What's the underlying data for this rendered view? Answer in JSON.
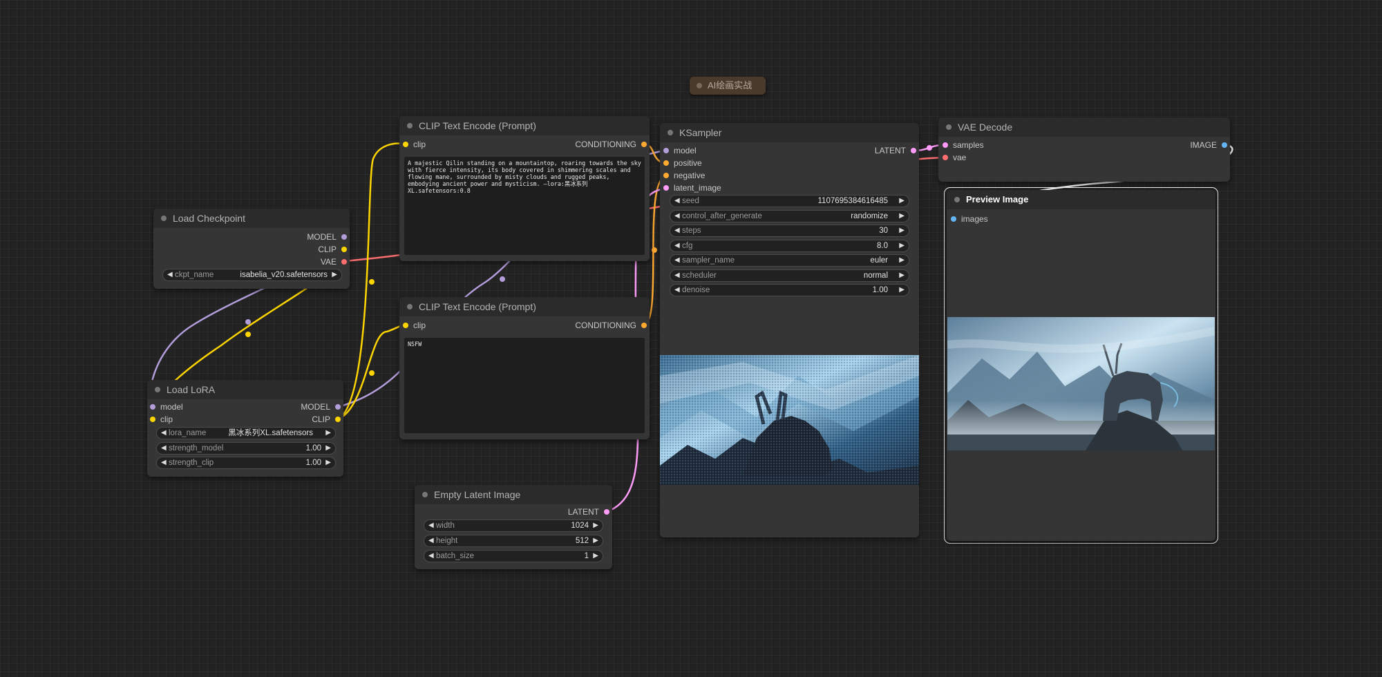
{
  "group": {
    "title": "AI绘画实战"
  },
  "colors": {
    "model": "#b39ddb",
    "clip": "#ffd500",
    "vae": "#ff6e6e",
    "conditioning": "#ffa931",
    "latent": "#ff9cf9",
    "image": "#64b5f6",
    "background": "#222222",
    "node_body": "#353535",
    "node_title": "#2b2b2b"
  },
  "nodes": {
    "load_checkpoint": {
      "title": "Load Checkpoint",
      "outputs": [
        "MODEL",
        "CLIP",
        "VAE"
      ],
      "widgets": [
        {
          "label": "ckpt_name",
          "value": "isabelia_v20.safetensors"
        }
      ]
    },
    "load_lora": {
      "title": "Load LoRA",
      "inputs": [
        "model",
        "clip"
      ],
      "outputs": [
        "MODEL",
        "CLIP"
      ],
      "widgets": [
        {
          "label": "lora_name",
          "value": "黑冰系列XL.safetensors"
        },
        {
          "label": "strength_model",
          "value": "1.00"
        },
        {
          "label": "strength_clip",
          "value": "1.00"
        }
      ]
    },
    "clip_text_pos": {
      "title": "CLIP Text Encode (Prompt)",
      "input": "clip",
      "output": "CONDITIONING",
      "text": "A majestic Qilin standing on a mountaintop, roaring towards the sky with fierce intensity, its body covered in shimmering scales and flowing mane, surrounded by misty clouds and rugged peaks, embodying ancient power and mysticism. —lora:黑冰系列XL.safetensors:0.8"
    },
    "clip_text_neg": {
      "title": "CLIP Text Encode (Prompt)",
      "input": "clip",
      "output": "CONDITIONING",
      "text": "NSFW"
    },
    "ksampler": {
      "title": "KSampler",
      "inputs": [
        "model",
        "positive",
        "negative",
        "latent_image"
      ],
      "output": "LATENT",
      "widgets": [
        {
          "label": "seed",
          "value": "1107695384616485"
        },
        {
          "label": "control_after_generate",
          "value": "randomize"
        },
        {
          "label": "steps",
          "value": "30"
        },
        {
          "label": "cfg",
          "value": "8.0"
        },
        {
          "label": "sampler_name",
          "value": "euler"
        },
        {
          "label": "scheduler",
          "value": "normal"
        },
        {
          "label": "denoise",
          "value": "1.00"
        }
      ]
    },
    "vae_decode": {
      "title": "VAE Decode",
      "inputs": [
        "samples",
        "vae"
      ],
      "output": "IMAGE"
    },
    "preview_image": {
      "title": "Preview Image",
      "input": "images"
    },
    "empty_latent": {
      "title": "Empty Latent Image",
      "output": "LATENT",
      "widgets": [
        {
          "label": "width",
          "value": "1024"
        },
        {
          "label": "height",
          "value": "512"
        },
        {
          "label": "batch_size",
          "value": "1"
        }
      ]
    }
  }
}
